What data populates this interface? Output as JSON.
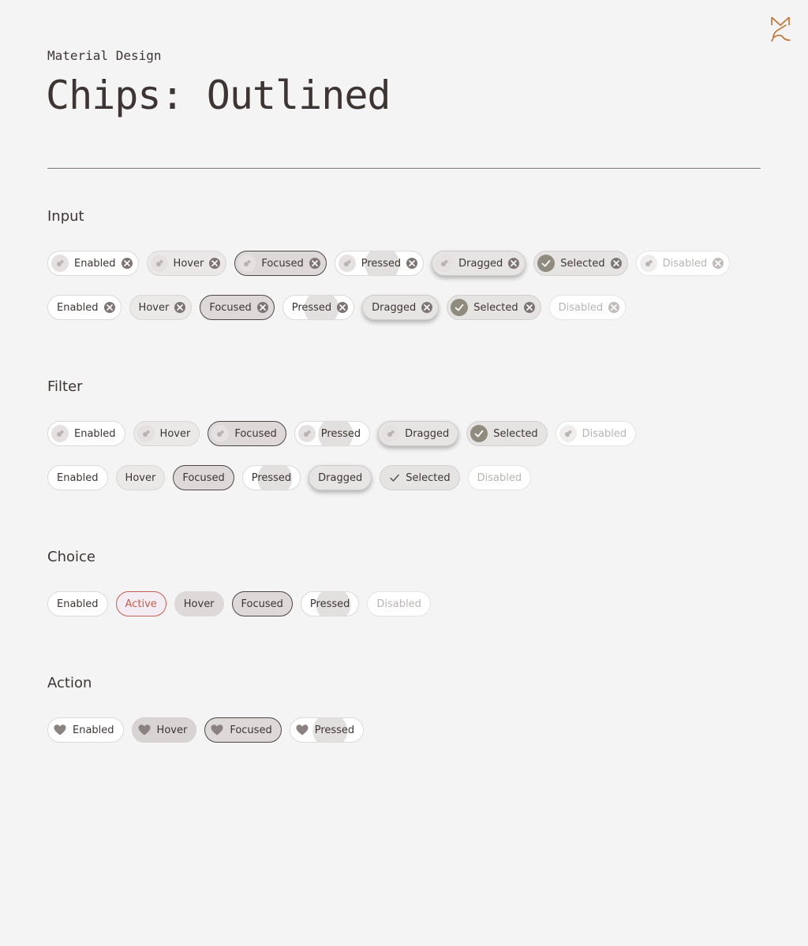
{
  "header": {
    "eyebrow": "Material Design",
    "title": "Chips: Outlined"
  },
  "colors": {
    "background": "#f4f4f4",
    "text": "#3d3533",
    "accent": "#c2604d",
    "logo": "#c2702d"
  },
  "sections": {
    "input": {
      "title": "Input",
      "row1": [
        "Enabled",
        "Hover",
        "Focused",
        "Pressed",
        "Dragged",
        "Selected",
        "Disabled"
      ],
      "row2": [
        "Enabled",
        "Hover",
        "Focused",
        "Pressed",
        "Dragged",
        "Selected",
        "Disabled"
      ]
    },
    "filter": {
      "title": "Filter",
      "row1": [
        "Enabled",
        "Hover",
        "Focused",
        "Pressed",
        "Dragged",
        "Selected",
        "Disabled"
      ],
      "row2": [
        "Enabled",
        "Hover",
        "Focused",
        "Pressed",
        "Dragged",
        "Selected",
        "Disabled"
      ]
    },
    "choice": {
      "title": "Choice",
      "row1": [
        "Enabled",
        "Active",
        "Hover",
        "Focused",
        "Pressed",
        "Disabled"
      ]
    },
    "action": {
      "title": "Action",
      "row1": [
        "Enabled",
        "Hover",
        "Focused",
        "Pressed"
      ]
    }
  },
  "icons": {
    "avatar": "avatar-icon",
    "remove": "close-circle-icon",
    "check": "check-icon",
    "heart": "heart-icon",
    "logo": "brand-logo-icon"
  }
}
